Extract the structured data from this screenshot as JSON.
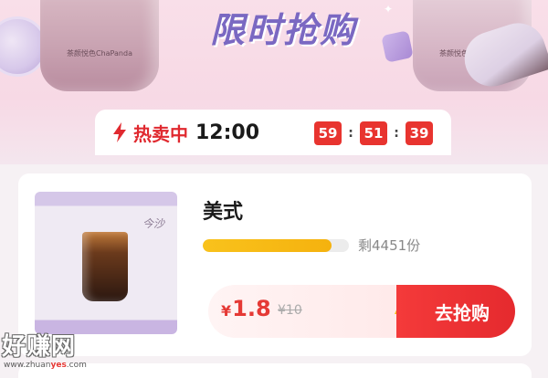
{
  "banner": {
    "headline": "限时抢购",
    "left_cup_brand": "茶颜悦色ChaPanda",
    "right_cup_brand": "茶颜悦色ChaPanda"
  },
  "flash_sale": {
    "status_label": "热卖中",
    "start_time": "12:00",
    "countdown": {
      "hours": "59",
      "minutes": "51",
      "seconds": "39"
    },
    "separator": ":"
  },
  "product": {
    "name": "美式",
    "image_caption": "今沙",
    "sold_fraction": 0.88,
    "stock_label": "剩4451份",
    "currency_symbol": "¥",
    "price": "1.8",
    "original_price": "¥10",
    "buy_label": "去抢购"
  },
  "watermark": {
    "title": "好赚网",
    "url_prefix": "www.zhuan",
    "url_highlight": "yes",
    "url_suffix": ".com"
  },
  "colors": {
    "accent_red": "#e53935",
    "headline_purple": "#7a68c2",
    "progress_yellow": "#f9c21c"
  }
}
